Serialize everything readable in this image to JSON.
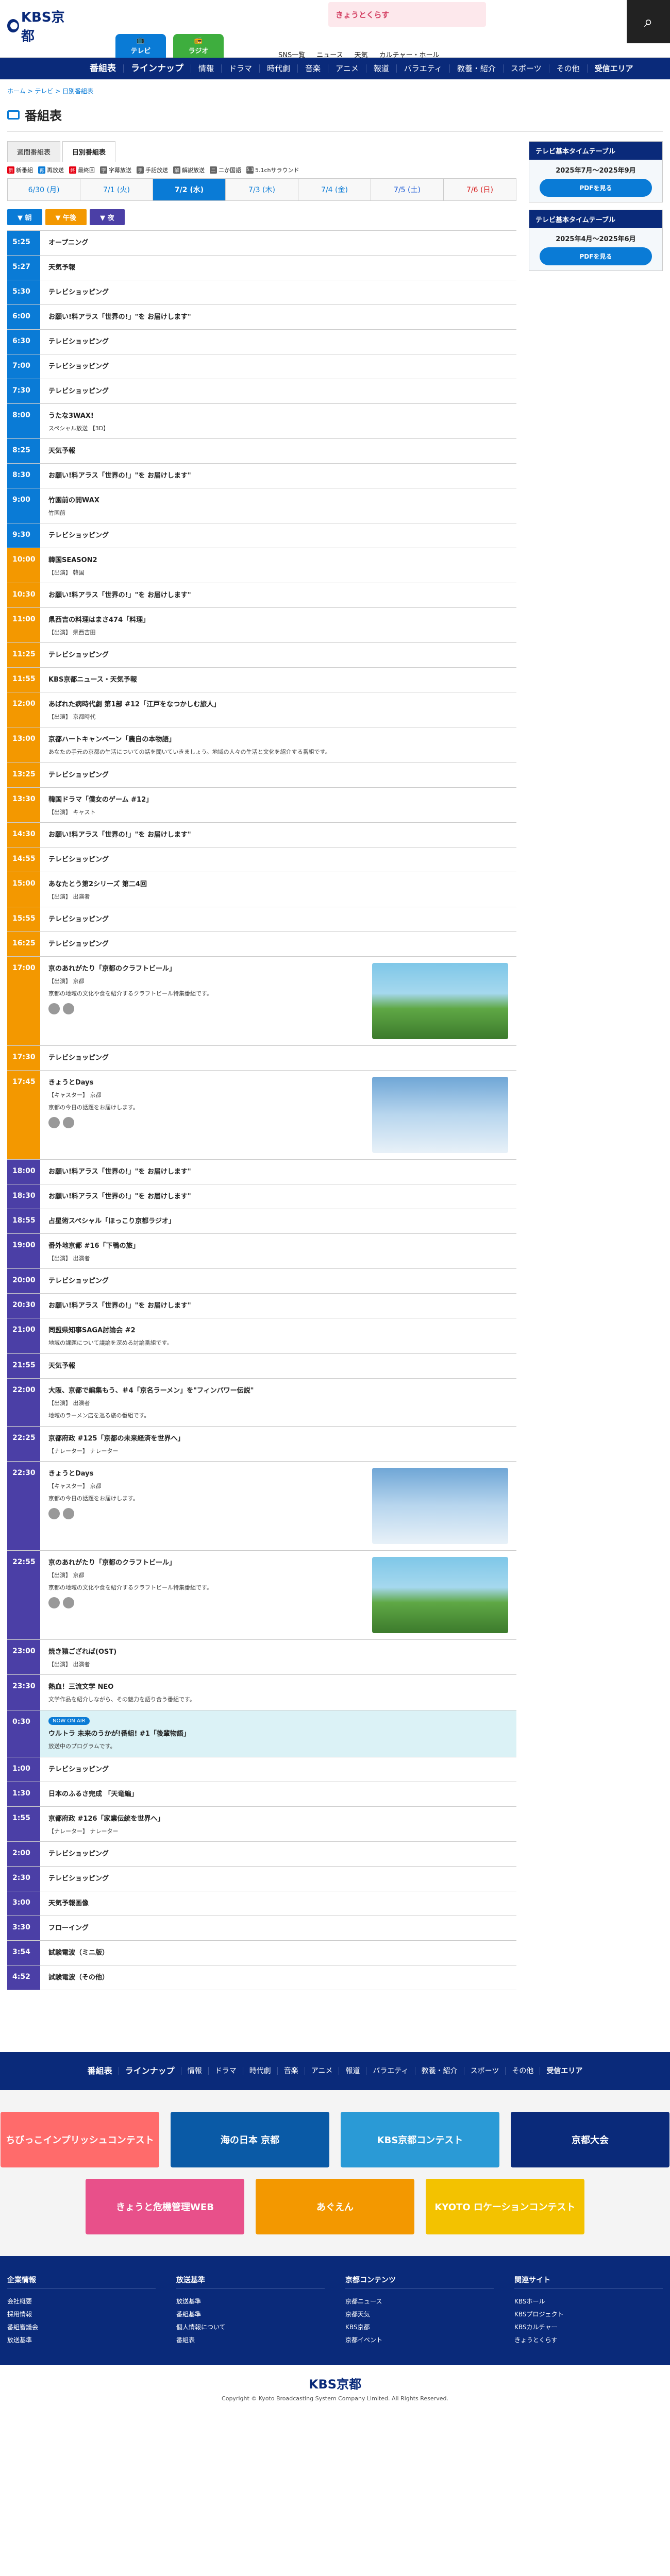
{
  "header": {
    "logo": "KBS京都",
    "top_banner": "きょうとくらす",
    "tv_label": "テレビ",
    "radio_label": "ラジオ",
    "top_links": [
      "SNS一覧",
      "ニュース",
      "天気",
      "カルチャー・ホール"
    ]
  },
  "gnav": {
    "big": "番組表",
    "items": [
      "ラインナップ",
      "情報",
      "ドラマ",
      "時代劇",
      "音楽",
      "アニメ",
      "報道",
      "バラエティ",
      "教養・紹介",
      "スポーツ",
      "その他"
    ],
    "last": "受信エリア"
  },
  "breadcrumb": "ホーム > テレビ > 日別番組表",
  "page_title": "番組表",
  "tabs": [
    "週間番組表",
    "日別番組表"
  ],
  "legend": [
    {
      "label": "新番組",
      "mark": "新",
      "color": "#e60012"
    },
    {
      "label": "再放送",
      "mark": "再",
      "color": "#0a7bd6"
    },
    {
      "label": "最終回",
      "mark": "終",
      "color": "#e60012"
    },
    {
      "label": "字幕放送",
      "mark": "字",
      "color": "#666666"
    },
    {
      "label": "手話放送",
      "mark": "手",
      "color": "#666666"
    },
    {
      "label": "解説放送",
      "mark": "解",
      "color": "#666666"
    },
    {
      "label": "二か国語",
      "mark": "二",
      "color": "#666666"
    },
    {
      "label": "5.1chサラウンド",
      "mark": "5.1",
      "color": "#666666"
    }
  ],
  "dates": [
    {
      "label": "6/30 (月)",
      "cls": ""
    },
    {
      "label": "7/1 (火)",
      "cls": ""
    },
    {
      "label": "7/2 (水)",
      "cls": "active"
    },
    {
      "label": "7/3 (木)",
      "cls": ""
    },
    {
      "label": "7/4 (金)",
      "cls": ""
    },
    {
      "label": "7/5 (土)",
      "cls": "sat"
    },
    {
      "label": "7/6 (日)",
      "cls": "sun"
    }
  ],
  "timeblocks": [
    "朝",
    "午後",
    "夜"
  ],
  "programs": [
    {
      "time": "5:25",
      "band": "m",
      "title": "オープニング"
    },
    {
      "time": "5:27",
      "band": "m",
      "title": "天気予報"
    },
    {
      "time": "5:30",
      "band": "m",
      "title": "テレビショッピング"
    },
    {
      "time": "6:00",
      "band": "m",
      "title": "お願い!料アラス「世界の!」\"を お届けします\""
    },
    {
      "time": "6:30",
      "band": "m",
      "title": "テレビショッピング"
    },
    {
      "time": "7:00",
      "band": "m",
      "title": "テレビショッピング"
    },
    {
      "time": "7:30",
      "band": "m",
      "title": "テレビショッピング"
    },
    {
      "time": "8:00",
      "band": "m",
      "title": "うたな3WAX!",
      "sub": "スペシャル放送 【3D】"
    },
    {
      "time": "8:25",
      "band": "m",
      "title": "天気予報"
    },
    {
      "time": "8:30",
      "band": "m",
      "title": "お願い!料アラス「世界の!」\"を お届けします\""
    },
    {
      "time": "9:00",
      "band": "m",
      "title": "竹園前の開WAX",
      "sub": "竹園前"
    },
    {
      "time": "9:30",
      "band": "m",
      "title": "テレビショッピング"
    },
    {
      "time": "10:00",
      "band": "d",
      "title": "韓国SEASON2",
      "sub": "【出演】 韓国"
    },
    {
      "time": "10:30",
      "band": "d",
      "title": "お願い!料アラス「世界の!」\"を お届けします\""
    },
    {
      "time": "11:00",
      "band": "d",
      "title": "県西吉の料理はまさ474「料理」",
      "sub": "【出演】 県西吉田"
    },
    {
      "time": "11:25",
      "band": "d",
      "title": "テレビショッピング"
    },
    {
      "time": "11:55",
      "band": "d",
      "title": "KBS京都ニュース・天気予報"
    },
    {
      "time": "12:00",
      "band": "d",
      "title": "あばれた病時代劇 第1部 #12「江戸をなつかしむ旅人」",
      "sub": "【出演】 京都時代"
    },
    {
      "time": "13:00",
      "band": "d",
      "title": "京都ハートキャンペーン「農自の本物語」",
      "desc": "あなたの手元の京都の生活についての話を聞いていきましょう。地域の人々の生活と文化を紹介する番組です。"
    },
    {
      "time": "13:25",
      "band": "d",
      "title": "テレビショッピング"
    },
    {
      "time": "13:30",
      "band": "d",
      "title": "韓国ドラマ「僕女のゲーム #12」",
      "sub": "【出演】 キャスト"
    },
    {
      "time": "14:30",
      "band": "d",
      "title": "お願い!料アラス「世界の!」\"を お届けします\""
    },
    {
      "time": "14:55",
      "band": "d",
      "title": "テレビショッピング"
    },
    {
      "time": "15:00",
      "band": "d",
      "title": "あなたとう第2シリーズ 第二4回",
      "sub": "【出演】 出演者"
    },
    {
      "time": "15:55",
      "band": "d",
      "title": "テレビショッピング"
    },
    {
      "time": "16:25",
      "band": "d",
      "title": "テレビショッピング"
    },
    {
      "time": "17:00",
      "band": "d",
      "title": "京のあれがたり「京都のクラフトビール」",
      "sub": "【出演】 京都",
      "desc": "京都の地域の文化や食を紹介するクラフトビール特集番組です。",
      "thumb": "river"
    },
    {
      "time": "17:30",
      "band": "d",
      "title": "テレビショッピング"
    },
    {
      "time": "17:45",
      "band": "d",
      "title": "きょうとDays",
      "sub": "【キャスター】 京都",
      "desc": "京都の今日の話題をお届けします。",
      "thumb": "studio"
    },
    {
      "time": "18:00",
      "band": "n",
      "title": "お願い!料アラス「世界の!」\"を お届けします\""
    },
    {
      "time": "18:30",
      "band": "n",
      "title": "お願い!料アラス「世界の!」\"を お届けします\""
    },
    {
      "time": "18:55",
      "band": "n",
      "title": "占星術スペシャル「ほっこり京都ラジオ」"
    },
    {
      "time": "19:00",
      "band": "n",
      "title": "番外地京都 #16「下鴨の旅」",
      "sub": "【出演】 出演者"
    },
    {
      "time": "20:00",
      "band": "n",
      "title": "テレビショッピング"
    },
    {
      "time": "20:30",
      "band": "n",
      "title": "お願い!料アラス「世界の!」\"を お届けします\""
    },
    {
      "time": "21:00",
      "band": "n",
      "title": "同盟県知事SAGA討論会 #2",
      "desc": "地域の課題について議論を深める討論番組です。"
    },
    {
      "time": "21:55",
      "band": "n",
      "title": "天気予報"
    },
    {
      "time": "22:00",
      "band": "n",
      "title": "大阪、京都で編集もう、＃4「京名ラーメン」を\"フィンパワー伝説\"",
      "sub": "【出演】 出演者",
      "desc": "地域のラーメン店を巡る旅の番組です。"
    },
    {
      "time": "22:25",
      "band": "n",
      "title": "京都府政 #125「京都の未来経済を世界へ」",
      "sub": "【ナレーター】 ナレーター"
    },
    {
      "time": "22:30",
      "band": "n",
      "title": "きょうとDays",
      "sub": "【キャスター】 京都",
      "desc": "京都の今日の話題をお届けします。",
      "thumb": "studio"
    },
    {
      "time": "22:55",
      "band": "n",
      "title": "京のあれがたり「京都のクラフトビール」",
      "sub": "【出演】 京都",
      "desc": "京都の地域の文化や食を紹介するクラフトビール特集番組です。",
      "thumb": "river"
    },
    {
      "time": "23:00",
      "band": "n",
      "title": "焼き猿ござれば(OST)",
      "sub": "【出演】 出演者"
    },
    {
      "time": "23:30",
      "band": "n",
      "title": "熱血！三流文学 NEO",
      "desc": "文学作品を紹介しながら、その魅力を語り合う番組です。"
    },
    {
      "time": "0:30",
      "band": "n",
      "title": "ウルトラ 未来のうかが!番組! #1「後輩物語」",
      "desc": "放送中のプログラムです。",
      "now": true
    },
    {
      "time": "1:00",
      "band": "n",
      "title": "テレビショッピング"
    },
    {
      "time": "1:30",
      "band": "n",
      "title": "日本のふるさ完成 「天竜編」"
    },
    {
      "time": "1:55",
      "band": "n",
      "title": "京都府政 #126「家業伝統を世界へ」",
      "sub": "【ナレーター】 ナレーター"
    },
    {
      "time": "2:00",
      "band": "n",
      "title": "テレビショッピング"
    },
    {
      "time": "2:30",
      "band": "n",
      "title": "テレビショッピング"
    },
    {
      "time": "3:00",
      "band": "n",
      "title": "天気予報画像"
    },
    {
      "time": "3:30",
      "band": "n",
      "title": "フローイング"
    },
    {
      "time": "3:54",
      "band": "n",
      "title": "試験電波（ミニ版）"
    },
    {
      "time": "4:52",
      "band": "n",
      "title": "試験電波（その他）"
    }
  ],
  "now_badge": "NOW ON AIR",
  "side": {
    "head1": "テレビ基本タイムテーブル",
    "label1": "2025年7月〜2025年9月",
    "pdf": "PDFを見る",
    "head2": "テレビ基本タイムテーブル",
    "label2": "2025年4月〜2025年6月"
  },
  "banners": [
    {
      "label": "ちびっこインプリッシュコンテスト",
      "color": "#ff6b6b"
    },
    {
      "label": "海の日本 京都",
      "color": "#0a5aa6"
    },
    {
      "label": "KBS京都コンテスト",
      "color": "#2a9ad6"
    },
    {
      "label": "京都大会",
      "color": "#0a2a7a"
    },
    {
      "label": "きょうと危機管理WEB",
      "color": "#e8508a"
    },
    {
      "label": "あぐえん",
      "color": "#f39800"
    },
    {
      "label": "KYOTO ロケーションコンテスト",
      "color": "#f3c200"
    }
  ],
  "footer_cols": [
    {
      "head": "企業情報",
      "items": [
        "会社概要",
        "採用情報",
        "番組審議会",
        "放送基準"
      ]
    },
    {
      "head": "放送基準",
      "items": [
        "放送基準",
        "番組基準",
        "個人情報について",
        "番組表"
      ]
    },
    {
      "head": "京都コンテンツ",
      "items": [
        "京都ニュース",
        "京都天気",
        "KBS京都",
        "京都イベント"
      ]
    },
    {
      "head": "関連サイト",
      "items": [
        "KBSホール",
        "KBSプロジェクト",
        "KBSカルチャー",
        "きょうとくらす"
      ]
    }
  ],
  "footer_logo": "KBS京都",
  "copyright": "Copyright © Kyoto Broadcasting System Company Limited. All Rights Reserved."
}
